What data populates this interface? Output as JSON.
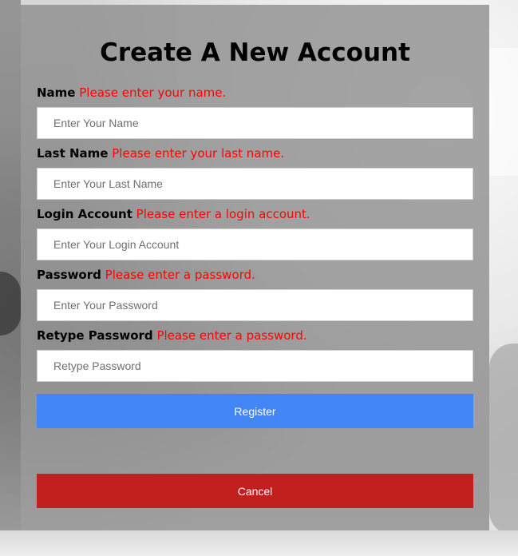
{
  "form": {
    "title": "Create A New Account",
    "fields": [
      {
        "label": "Name",
        "error": "Please enter your name.",
        "placeholder": "Enter Your Name",
        "value": ""
      },
      {
        "label": "Last Name",
        "error": "Please enter your last name.",
        "placeholder": "Enter Your Last Name",
        "value": ""
      },
      {
        "label": "Login Account",
        "error": "Please enter a login account.",
        "placeholder": "Enter Your Login Account",
        "value": ""
      },
      {
        "label": "Password",
        "error": "Please enter a password.",
        "placeholder": "Enter Your Password",
        "value": ""
      },
      {
        "label": "Retype Password",
        "error": "Please enter a password.",
        "placeholder": "Retype Password",
        "value": ""
      }
    ],
    "register_label": "Register",
    "cancel_label": "Cancel"
  },
  "colors": {
    "error": "#ff0000",
    "register": "#4285f4",
    "cancel": "#c21f1f",
    "panel": "#8c8c8c"
  }
}
